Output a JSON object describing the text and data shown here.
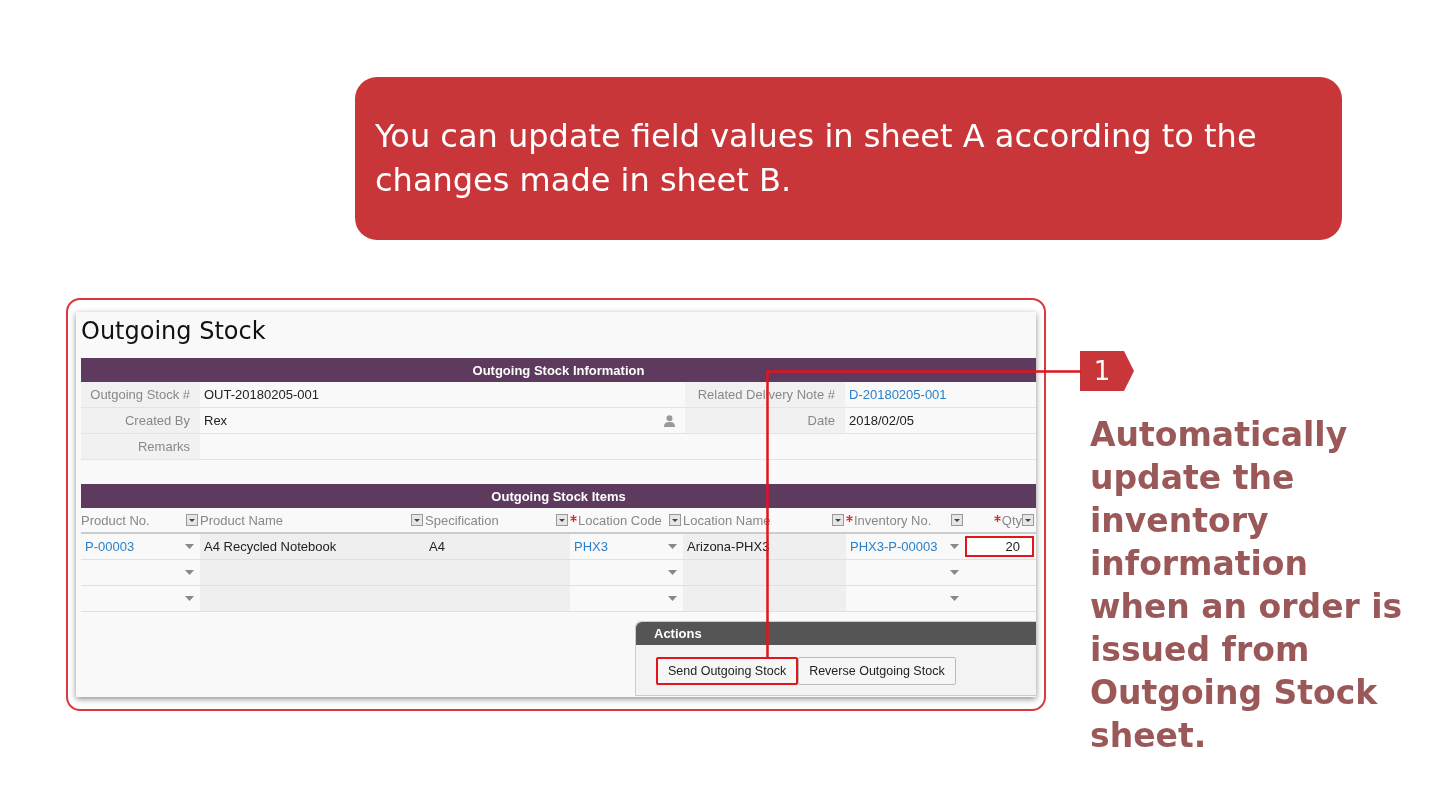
{
  "banner": {
    "text": "You can update field values in sheet A according to the changes made in sheet B."
  },
  "form": {
    "title": "Outgoing Stock",
    "info_section": {
      "header": "Outgoing Stock Information",
      "rows": [
        {
          "cells": [
            {
              "label": "Outgoing Stock #",
              "value": "OUT-20180205-001",
              "kind": "text"
            },
            {
              "label": "Related Delivery Note #",
              "value": "D-20180205-001",
              "kind": "link"
            }
          ]
        },
        {
          "cells": [
            {
              "label": "Created By",
              "value": "Rex",
              "kind": "user"
            },
            {
              "label": "Date",
              "value": "2018/02/05",
              "kind": "text"
            }
          ]
        },
        {
          "cells": [
            {
              "label": "Remarks",
              "kind": "text"
            }
          ]
        }
      ]
    },
    "items_section": {
      "header": "Outgoing Stock Items",
      "columns": [
        {
          "label": "Product No.",
          "required": false,
          "kind": "link-select"
        },
        {
          "label": "Product Name",
          "required": false,
          "kind": "readonly"
        },
        {
          "label": "Specification",
          "required": false,
          "kind": "readonly"
        },
        {
          "label": "Location Code",
          "required": true,
          "kind": "link-select"
        },
        {
          "label": "Location Name",
          "required": false,
          "kind": "readonly"
        },
        {
          "label": "Inventory No.",
          "required": true,
          "kind": "link-select"
        },
        {
          "label": "Qty",
          "required": true,
          "kind": "number"
        }
      ],
      "rows": [
        {
          "kind": "item",
          "qty_highlighted": true,
          "cells": [
            "P-00003",
            "A4 Recycled Notebook",
            "A4",
            "PHX3",
            "Arizona-PHX3",
            "PHX3-P-00003",
            "20"
          ]
        },
        {
          "kind": "blank"
        },
        {
          "kind": "blank"
        }
      ]
    },
    "actions": {
      "header": "Actions",
      "buttons": [
        {
          "label": "Send Outgoing Stock",
          "highlighted": true
        },
        {
          "label": "Reverse Outgoing Stock",
          "highlighted": false
        }
      ]
    }
  },
  "callout": {
    "number": "1",
    "text": "Automatically update the inventory information when an order is issued from Outgoing Stock sheet."
  }
}
